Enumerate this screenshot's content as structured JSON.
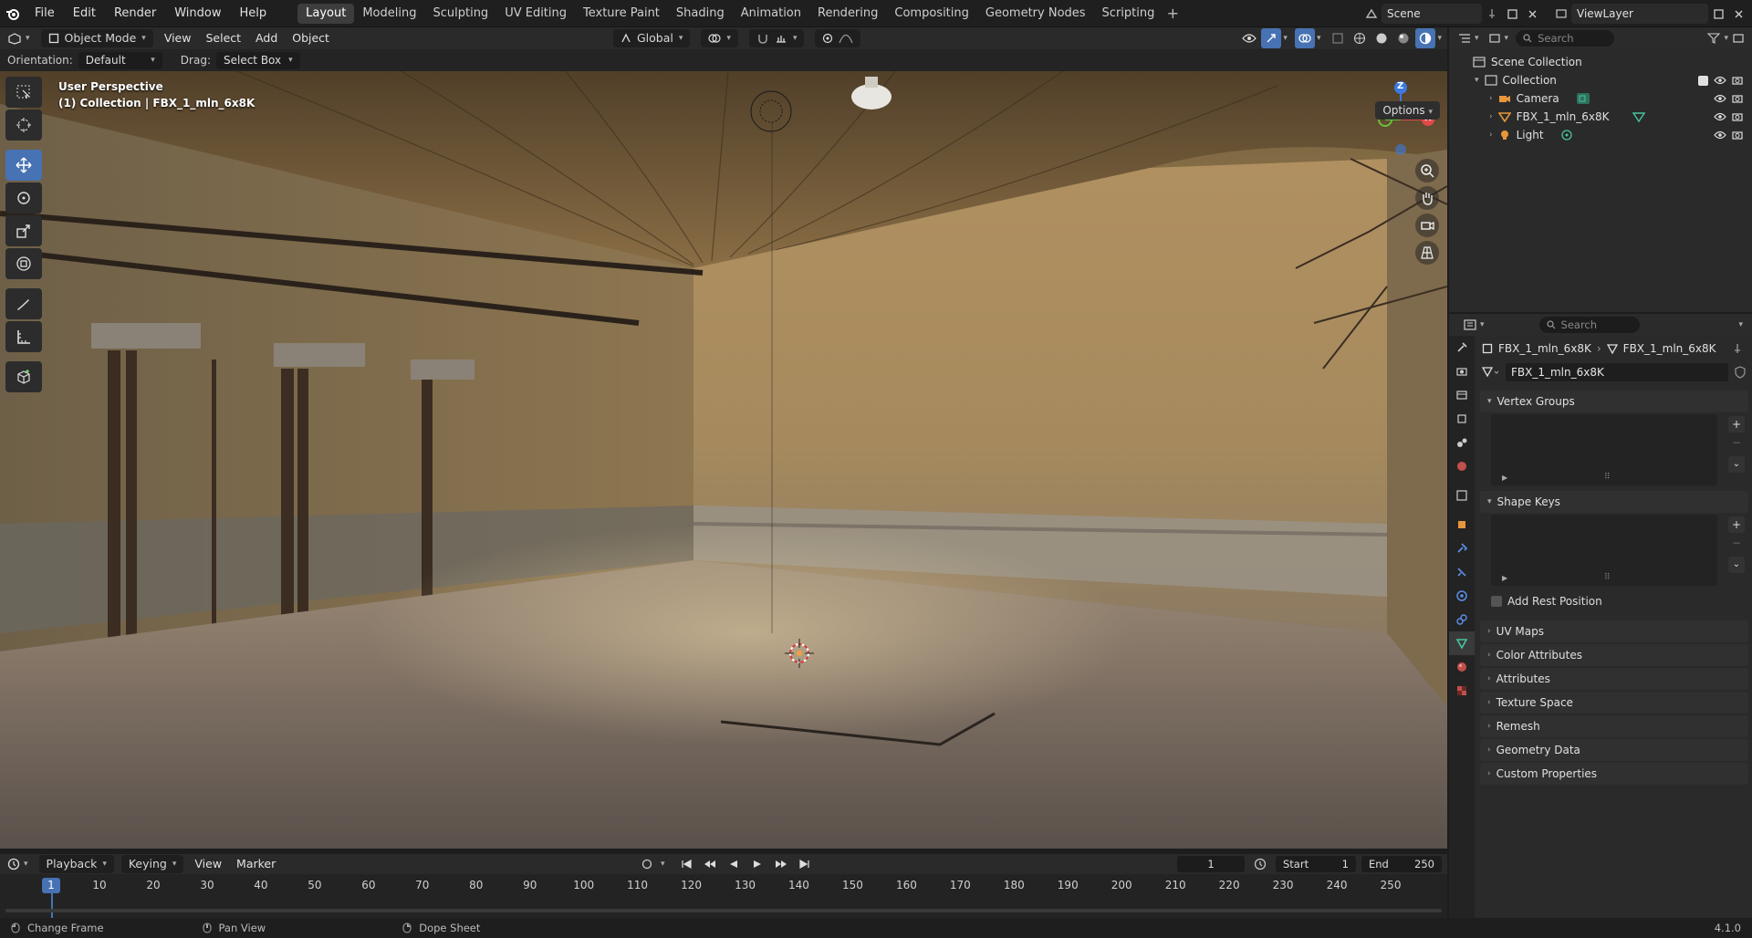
{
  "menu": [
    "File",
    "Edit",
    "Render",
    "Window",
    "Help"
  ],
  "workspaces": [
    "Layout",
    "Modeling",
    "Sculpting",
    "UV Editing",
    "Texture Paint",
    "Shading",
    "Animation",
    "Rendering",
    "Compositing",
    "Geometry Nodes",
    "Scripting"
  ],
  "active_workspace": "Layout",
  "top_right": {
    "scene": "Scene",
    "view_layer": "ViewLayer"
  },
  "viewport_header": {
    "mode": "Object Mode",
    "menus": [
      "View",
      "Select",
      "Add",
      "Object"
    ],
    "transform_orientation": "Global"
  },
  "tool_settings": {
    "orientation_label": "Orientation:",
    "orientation_value": "Default",
    "drag_label": "Drag:",
    "drag_value": "Select Box",
    "options": "Options"
  },
  "viewport": {
    "perspective": "User Perspective",
    "collection_info": "(1) Collection | FBX_1_mln_6x8K",
    "gizmo": {
      "x": "X",
      "y": "Y",
      "z": "Z"
    }
  },
  "outliner": {
    "search_placeholder": "Search",
    "root": "Scene Collection",
    "collection": "Collection",
    "objects": [
      "Camera",
      "FBX_1_mln_6x8K",
      "Light"
    ]
  },
  "properties": {
    "search_placeholder": "Search",
    "breadcrumb_object": "FBX_1_mln_6x8K",
    "breadcrumb_data": "FBX_1_mln_6x8K",
    "mesh_name": "FBX_1_mln_6x8K",
    "panels_expanded": [
      "Vertex Groups",
      "Shape Keys"
    ],
    "add_rest_position": "Add Rest Position",
    "panels_collapsed": [
      "UV Maps",
      "Color Attributes",
      "Attributes",
      "Texture Space",
      "Remesh",
      "Geometry Data",
      "Custom Properties"
    ]
  },
  "timeline": {
    "menus": [
      "Playback",
      "Keying",
      "View",
      "Marker"
    ],
    "current_frame": "1",
    "start_label": "Start",
    "start": "1",
    "end_label": "End",
    "end": "250",
    "ticks": [
      "10",
      "20",
      "30",
      "40",
      "50",
      "60",
      "70",
      "80",
      "90",
      "100",
      "110",
      "120",
      "130",
      "140",
      "150",
      "160",
      "170",
      "180",
      "190",
      "200",
      "210",
      "220",
      "230",
      "240",
      "250"
    ]
  },
  "statusbar": {
    "items": [
      "Change Frame",
      "Pan View",
      "Dope Sheet"
    ],
    "version": "4.1.0"
  },
  "colors": {
    "accent": "#4772b3",
    "active_tab": "#3d3d3d",
    "mesh_icon": "#45c4a0",
    "object_icon": "#e8963b"
  }
}
